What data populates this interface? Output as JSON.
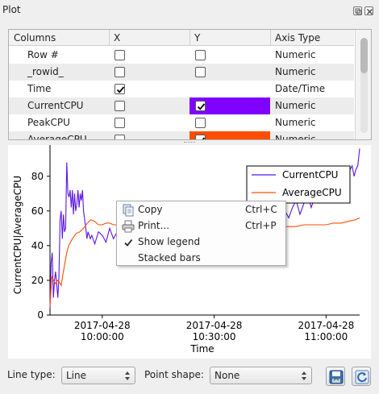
{
  "window": {
    "title": "Plot",
    "float_icon": "float-icon",
    "close_icon": "close-icon"
  },
  "columns_table": {
    "headers": [
      "Columns",
      "X",
      "Y",
      "Axis Type"
    ],
    "rows": [
      {
        "name": "Row #",
        "x": false,
        "y": false,
        "y_highlight": null,
        "axis": "Numeric"
      },
      {
        "name": "_rowid_",
        "x": false,
        "y": false,
        "y_highlight": null,
        "axis": "Numeric"
      },
      {
        "name": "Time",
        "x": true,
        "y": null,
        "y_highlight": null,
        "axis": "Date/Time"
      },
      {
        "name": "CurrentCPU",
        "x": false,
        "y": true,
        "y_highlight": "#7f00ff",
        "axis": "Numeric"
      },
      {
        "name": "PeakCPU",
        "x": false,
        "y": false,
        "y_highlight": null,
        "axis": "Numeric"
      },
      {
        "name": "AverageCPU",
        "x": false,
        "y": true,
        "y_highlight": "#ff4d00",
        "axis": "Numeric"
      }
    ]
  },
  "chart_data": {
    "type": "line",
    "xlabel": "Time",
    "ylabel": "CurrentCPU|AverageCPU",
    "ylim": [
      0,
      98
    ],
    "yticks": [
      0,
      20,
      40,
      60,
      80
    ],
    "xtick_labels": [
      {
        "date": "2017-04-28",
        "time": "10:00:00"
      },
      {
        "date": "2017-04-28",
        "time": "10:30:00"
      },
      {
        "date": "2017-04-28",
        "time": "11:00:00"
      }
    ],
    "x_range_minutes_after_10am": [
      -14,
      69
    ],
    "xticks_minutes_after_10am": [
      0,
      30,
      60
    ],
    "legend_position": "top-right",
    "series": [
      {
        "name": "CurrentCPU",
        "color": "#5b14e0",
        "x_minutes_after_10am": [
          -14,
          -13.7,
          -13.4,
          -13.1,
          -12.8,
          -12.5,
          -12.2,
          -11.9,
          -11.6,
          -11.3,
          -11,
          -10.7,
          -10.4,
          -10.1,
          -9.8,
          -9.5,
          -9.2,
          -8.9,
          -8.6,
          -8.3,
          -8,
          -7.7,
          -7.4,
          -7.1,
          -6.8,
          -6.5,
          -6.2,
          -5.9,
          -5.6,
          -5.3,
          -5,
          -4.7,
          -4.4,
          -4.1,
          -3.8,
          -3.2,
          -2.8,
          -2,
          -1,
          0,
          1,
          2,
          3,
          4,
          5,
          6,
          7,
          8,
          9,
          10,
          11,
          12,
          13,
          14,
          15,
          16,
          17,
          18,
          19,
          20,
          21,
          22,
          23,
          24,
          25,
          26,
          27,
          28,
          29,
          30,
          31,
          32,
          33,
          34,
          35,
          36,
          37,
          38,
          39,
          40,
          41,
          42,
          43,
          44,
          45,
          46,
          47,
          48,
          49,
          50,
          51,
          52,
          53,
          54,
          55,
          56,
          57,
          58,
          59,
          60,
          61,
          62,
          63,
          64,
          65,
          66,
          67,
          67.5,
          68,
          68.5,
          69
        ],
        "values": [
          4,
          30,
          36,
          10,
          20,
          25,
          18,
          10,
          22,
          55,
          60,
          44,
          58,
          48,
          50,
          88,
          70,
          68,
          72,
          62,
          72,
          58,
          70,
          60,
          64,
          72,
          62,
          70,
          66,
          72,
          60,
          55,
          50,
          44,
          48,
          44,
          46,
          41,
          48,
          46,
          42,
          50,
          44,
          48,
          52,
          42,
          46,
          50,
          48,
          44,
          48,
          44,
          42,
          46,
          50,
          52,
          56,
          50,
          54,
          52,
          50,
          56,
          54,
          52,
          48,
          50,
          54,
          52,
          56,
          52,
          56,
          54,
          52,
          56,
          54,
          60,
          56,
          52,
          58,
          62,
          56,
          60,
          64,
          58,
          62,
          60,
          58,
          64,
          60,
          56,
          62,
          66,
          58,
          64,
          70,
          62,
          68,
          72,
          66,
          74,
          70,
          78,
          74,
          80,
          76,
          82,
          86,
          80,
          84,
          86,
          96,
          90,
          84,
          86,
          80
        ]
      },
      {
        "name": "AverageCPU",
        "color": "#ff4d00",
        "x_minutes_after_10am": [
          -14,
          -13.5,
          -13,
          -12.5,
          -12,
          -11.5,
          -11,
          -10.5,
          -10,
          -9.5,
          -9,
          -8,
          -7,
          -6,
          -5,
          -4,
          -3,
          -2,
          -1,
          0,
          1,
          2,
          3,
          4,
          5,
          6,
          8,
          10,
          12,
          14,
          16,
          18,
          20,
          22,
          24,
          26,
          28,
          30,
          32,
          34,
          36,
          38,
          40,
          42,
          44,
          46,
          48,
          50,
          52,
          54,
          56,
          58,
          60,
          62,
          64,
          66,
          68,
          69
        ],
        "values": [
          5,
          22,
          20,
          18,
          20,
          19,
          17,
          24,
          30,
          36,
          40,
          44,
          47,
          48,
          50,
          53,
          55,
          54,
          52,
          52,
          53,
          53,
          52,
          52,
          52,
          51,
          51,
          51,
          50,
          51,
          51,
          51,
          51,
          51,
          51,
          51,
          51,
          51,
          51,
          51,
          51,
          51,
          51,
          51,
          51,
          51,
          51,
          51,
          51,
          52,
          52,
          52,
          52,
          53,
          53,
          54,
          55,
          56
        ]
      }
    ]
  },
  "context_menu": {
    "items": [
      {
        "label": "Copy",
        "shortcut": "Ctrl+C",
        "icon": "copy-icon"
      },
      {
        "label": "Print...",
        "shortcut": "Ctrl+P",
        "icon": "printer-icon"
      },
      {
        "label": "Show legend",
        "shortcut": "",
        "icon": "checkmark-icon",
        "checked": true
      },
      {
        "label": "Stacked bars",
        "shortcut": "",
        "icon": "",
        "checked": false
      }
    ]
  },
  "bottom_bar": {
    "line_type_label": "Line type:",
    "line_type_value": "Line",
    "point_shape_label": "Point shape:",
    "point_shape_value": "None",
    "save_icon": "save-plot-icon",
    "refresh_icon": "refresh-icon"
  }
}
